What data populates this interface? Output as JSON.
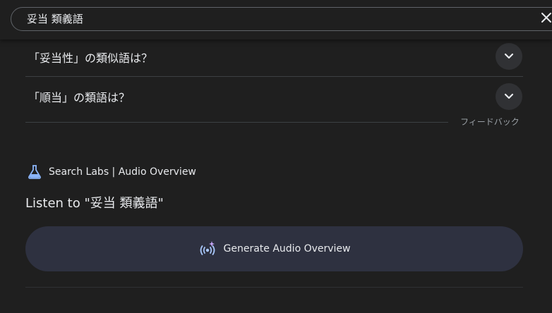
{
  "search": {
    "query": "妥当 類義語"
  },
  "faq": {
    "items": [
      {
        "question": "「妥当性」の類似語は？"
      },
      {
        "question": "「順当」の類語は？"
      }
    ],
    "feedback_label": "フィードバック"
  },
  "audio_overview": {
    "section_title": "Search Labs | Audio Overview",
    "heading": "Listen to \"妥当 類義語\"",
    "button_label": "Generate Audio Overview"
  },
  "colors": {
    "background": "#1f1f1f",
    "button_bg": "#2e3140",
    "accent_blue": "#8ab4f8",
    "divider": "#3c4043"
  },
  "icons": [
    "close-icon",
    "chevron-down-icon",
    "labs-flask-icon",
    "audio-spark-icon"
  ]
}
